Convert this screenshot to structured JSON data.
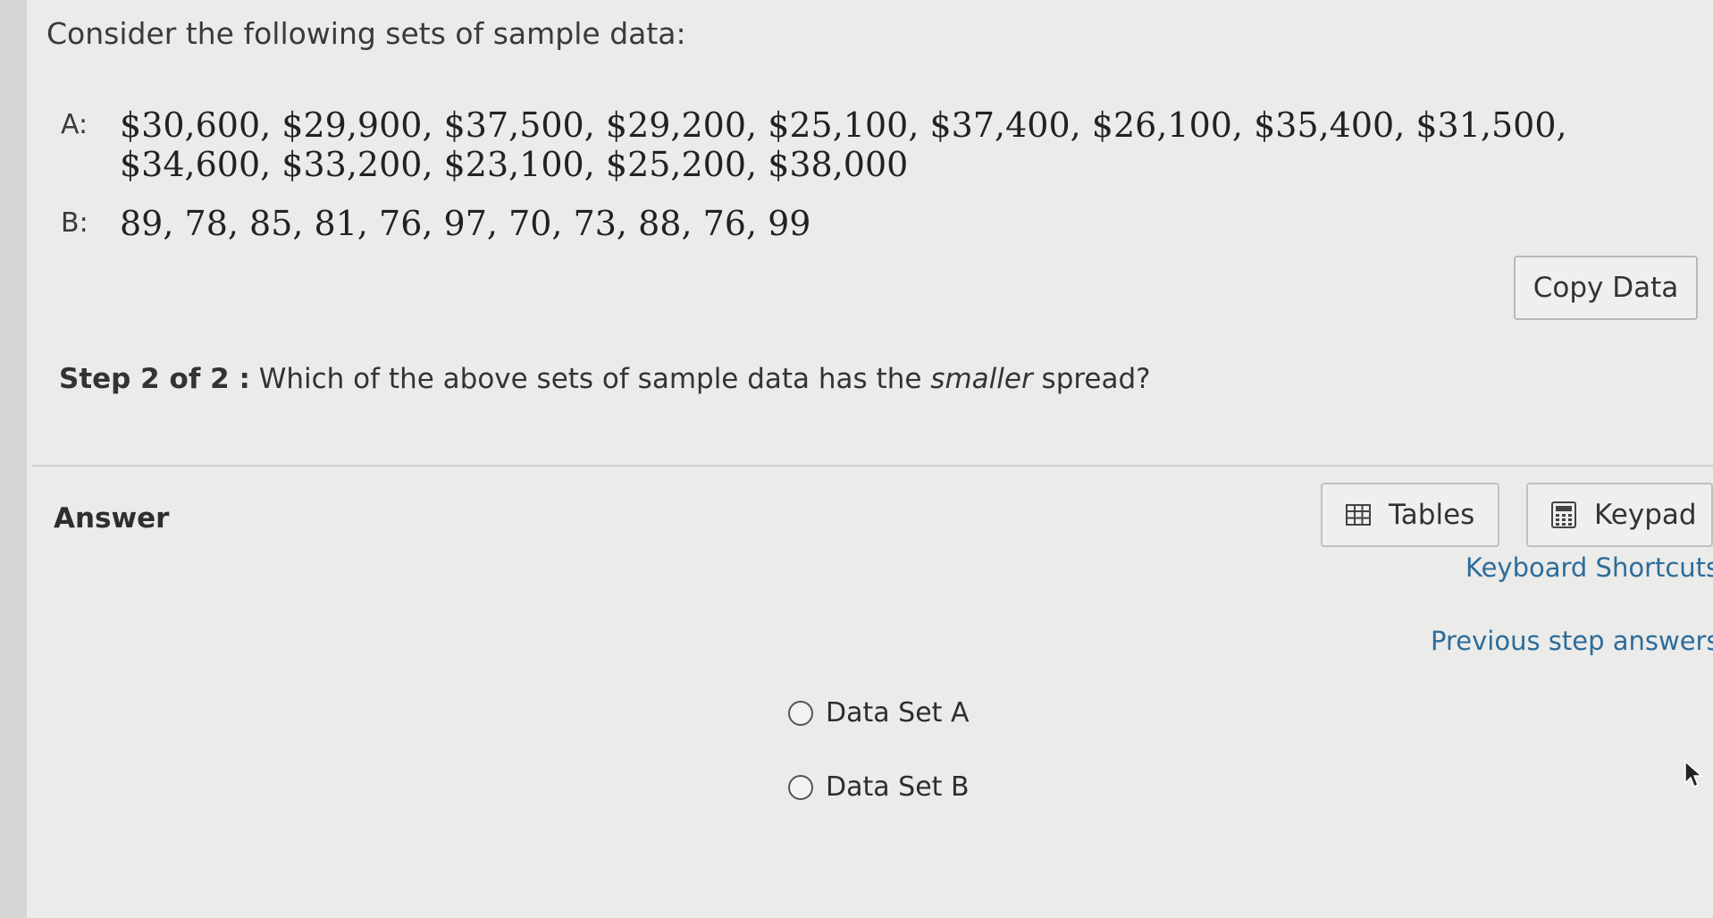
{
  "intro": "Consider the following sets of sample data:",
  "sets": [
    {
      "label": "A:",
      "values": "$30,600, $29,900, $37,500, $29,200, $25,100, $37,400, $26,100, $35,400, $31,500, $34,600, $33,200, $23,100, $25,200, $38,000"
    },
    {
      "label": "B:",
      "values": "89, 78, 85, 81, 76, 97, 70, 73, 88, 76, 99"
    }
  ],
  "copy_button": "Copy Data",
  "step": {
    "number": "Step 2 of 2 :",
    "question_before": "Which of the above sets of sample data has the ",
    "question_emphasis": "smaller",
    "question_after": " spread?"
  },
  "answer": {
    "title": "Answer",
    "tables_label": "Tables",
    "keypad_label": "Keypad",
    "keyboard_shortcuts": "Keyboard Shortcuts",
    "previous_answers": "Previous step answers",
    "options": [
      "Data Set A",
      "Data Set B"
    ]
  },
  "icons": {
    "tables": "table-grid-icon",
    "keypad": "calculator-icon",
    "radio": "radio-circle-icon",
    "cursor": "mouse-pointer-icon"
  },
  "colors": {
    "link": "#2c6c9a",
    "background": "#ebebe9"
  }
}
